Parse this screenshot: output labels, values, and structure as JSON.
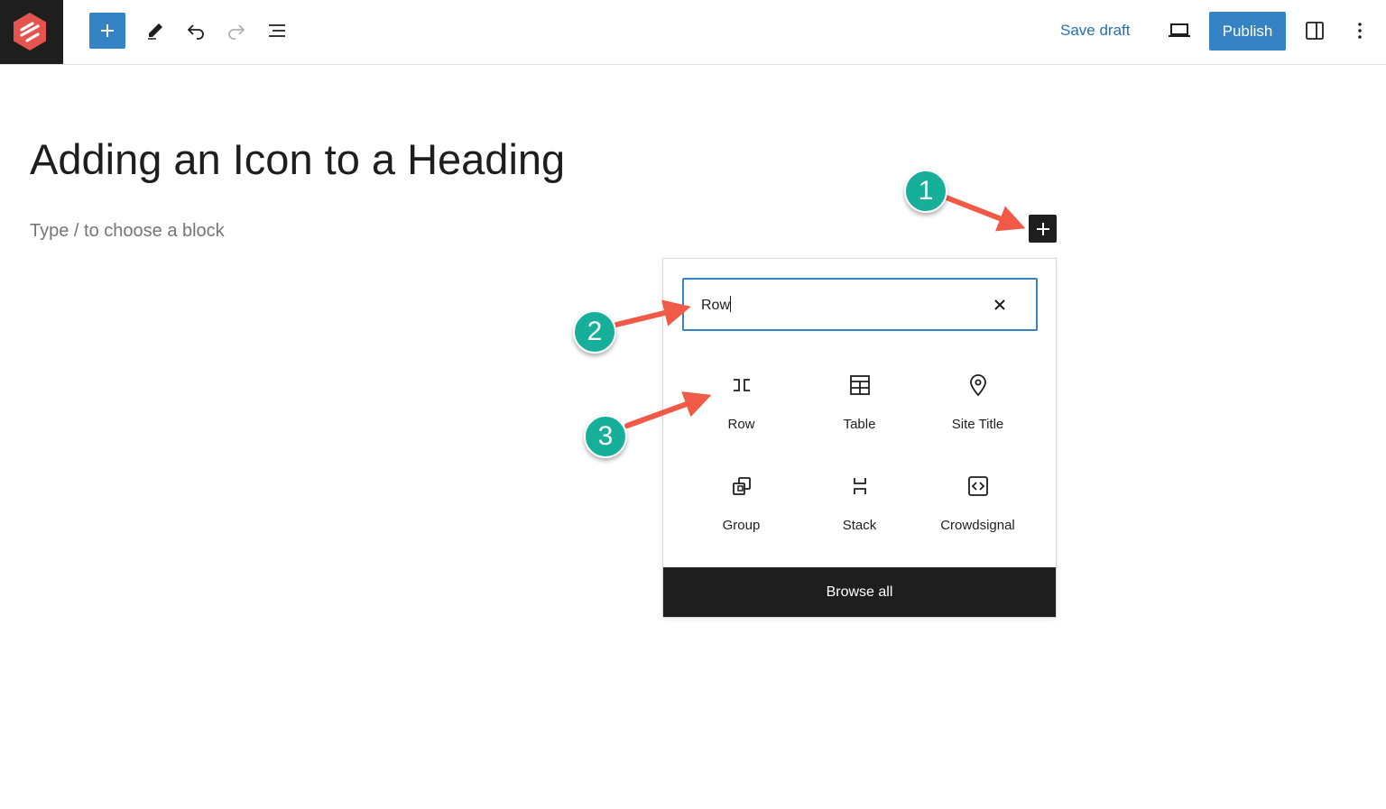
{
  "toolbar": {
    "logo_icon": "hexagon-logo-icon",
    "save_draft_label": "Save draft",
    "publish_label": "Publish",
    "accent_color": "#3582c4"
  },
  "editor": {
    "post_title": "Adding an Icon to a Heading",
    "block_placeholder": "Type / to choose a block"
  },
  "inserter": {
    "search_value": "Row",
    "blocks": [
      {
        "label": "Row",
        "icon": "row-icon"
      },
      {
        "label": "Table",
        "icon": "table-icon"
      },
      {
        "label": "Site Title",
        "icon": "map-marker-icon"
      },
      {
        "label": "Group",
        "icon": "group-icon"
      },
      {
        "label": "Stack",
        "icon": "stack-icon"
      },
      {
        "label": "Crowdsignal",
        "icon": "code-embed-icon"
      }
    ],
    "browse_all_label": "Browse all"
  },
  "annotations": {
    "badge_color": "#16b09a",
    "arrow_color": "#f05a47",
    "badges": [
      "1",
      "2",
      "3"
    ]
  }
}
